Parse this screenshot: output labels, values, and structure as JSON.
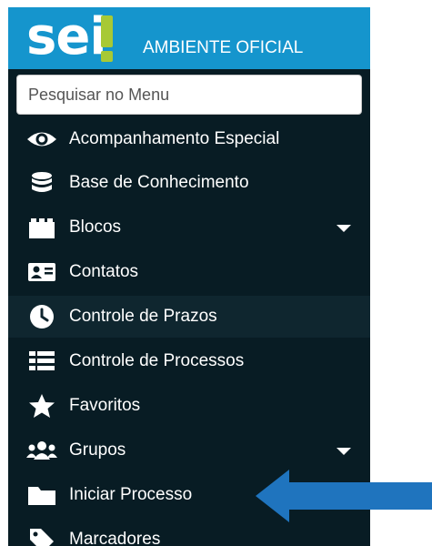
{
  "header": {
    "logo_text": "sei",
    "environment": "AMBIENTE OFICIAL"
  },
  "search": {
    "placeholder": "Pesquisar no Menu"
  },
  "menu": [
    {
      "label": "Acompanhamento Especial",
      "icon": "eye-icon"
    },
    {
      "label": "Base de Conhecimento",
      "icon": "database-icon"
    },
    {
      "label": "Blocos",
      "icon": "blocks-icon",
      "has_submenu": true
    },
    {
      "label": "Contatos",
      "icon": "contact-card-icon"
    },
    {
      "label": "Controle de Prazos",
      "icon": "clock-icon",
      "highlighted": true
    },
    {
      "label": "Controle de Processos",
      "icon": "list-icon"
    },
    {
      "label": "Favoritos",
      "icon": "star-icon"
    },
    {
      "label": "Grupos",
      "icon": "users-icon",
      "has_submenu": true
    },
    {
      "label": "Iniciar Processo",
      "icon": "folder-icon"
    },
    {
      "label": "Marcadores",
      "icon": "tag-icon"
    }
  ],
  "colors": {
    "header_bg": "#1595cd",
    "sidebar_bg": "#081c24",
    "logo_accent": "#a7c935",
    "annotation_arrow": "#1f74be"
  }
}
